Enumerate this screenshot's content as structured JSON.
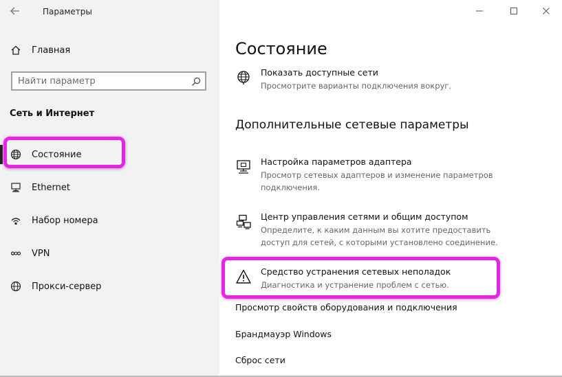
{
  "window": {
    "title": "Параметры",
    "controls": {
      "minimize": "minimize-icon",
      "maximize": "maximize-icon",
      "close": "close-icon"
    }
  },
  "sidebar": {
    "home_label": "Главная",
    "search": {
      "placeholder": "Найти параметр"
    },
    "section_title": "Сеть и Интернет",
    "items": [
      {
        "label": "Состояние",
        "icon": "globe-icon",
        "active": true
      },
      {
        "label": "Ethernet",
        "icon": "ethernet-icon"
      },
      {
        "label": "Набор номера",
        "icon": "dialup-icon"
      },
      {
        "label": "VPN",
        "icon": "vpn-icon"
      },
      {
        "label": "Прокси-сервер",
        "icon": "globe-icon"
      }
    ]
  },
  "main": {
    "page_title": "Состояние",
    "show_networks": {
      "title": "Показать доступные сети",
      "description": "Просмотрите варианты подключения вокруг.",
      "icon": "globe-icon"
    },
    "advanced_title": "Дополнительные сетевые параметры",
    "advanced_items": [
      {
        "title": "Настройка параметров адаптера",
        "description": "Просмотр сетевых адаптеров и изменение параметров подключения.",
        "icon": "adapter-icon"
      },
      {
        "title": "Центр управления сетями и общим доступом",
        "description": "Определите, к каким данным вы хотите предоставить доступ для сетей, с которыми установлено соединение.",
        "icon": "network-center-icon"
      },
      {
        "title": "Средство устранения сетевых неполадок",
        "description": "Диагностика и устранение проблем с сетью.",
        "icon": "warning-icon"
      }
    ],
    "links": [
      "Просмотр свойств оборудования и подключения",
      "Брандмауэр Windows",
      "Сброс сети"
    ]
  },
  "colors": {
    "sidebar_bg": "#f2f2f2",
    "highlight": "#e524e4",
    "text": "#111111",
    "secondary_text": "#666666"
  }
}
